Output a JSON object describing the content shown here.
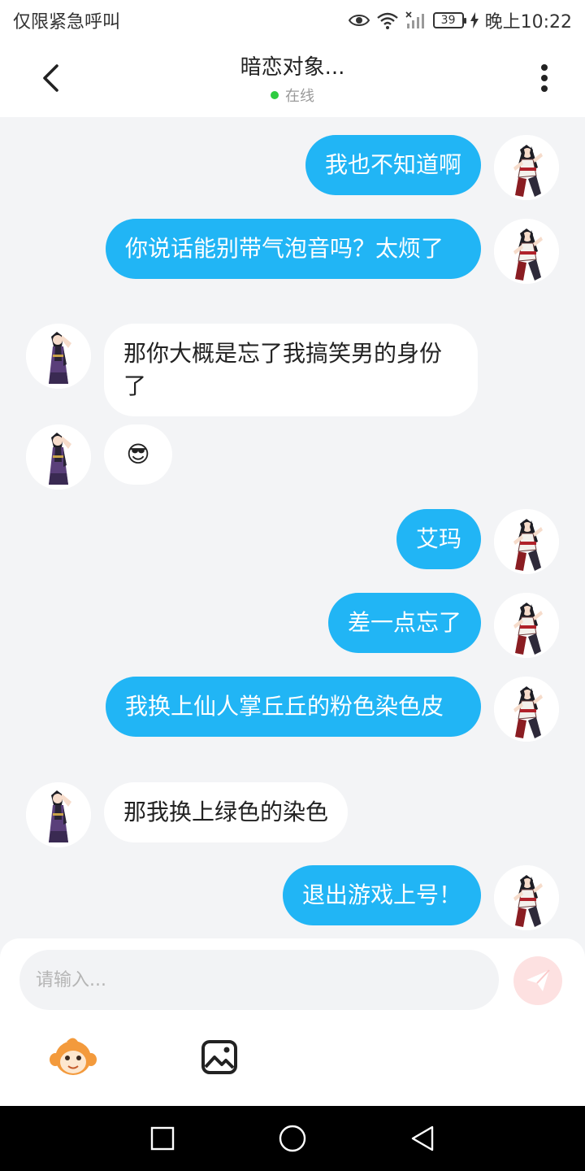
{
  "status_bar": {
    "left_text": "仅限紧急呼叫",
    "battery": "39",
    "time": "晚上10:22"
  },
  "header": {
    "title": "暗恋对象...",
    "status": "在线",
    "status_color": "#2ecc40"
  },
  "colors": {
    "self_bubble": "#21b5f5",
    "other_bubble": "#ffffff",
    "background": "#f3f4f6"
  },
  "messages": [
    {
      "sender": "self",
      "text": "我也不知道啊"
    },
    {
      "sender": "self",
      "text": "你说话能别带气泡音吗？太烦了"
    },
    {
      "sender": "other",
      "text": "那你大概是忘了我搞笑男的身份了"
    },
    {
      "sender": "other",
      "text": "😎"
    },
    {
      "sender": "self",
      "text": "艾玛"
    },
    {
      "sender": "self",
      "text": "差一点忘了"
    },
    {
      "sender": "self",
      "text": "我换上仙人掌丘丘的粉色染色皮"
    },
    {
      "sender": "other",
      "text": "那我换上绿色的染色"
    },
    {
      "sender": "self",
      "text": "退出游戏上号！"
    }
  ],
  "composer": {
    "placeholder": "请输入...",
    "icons": [
      "monkey-emoji-icon",
      "image-icon",
      "send-icon"
    ]
  },
  "nav": {
    "icons": [
      "recent-apps-icon",
      "home-icon",
      "back-icon"
    ]
  }
}
